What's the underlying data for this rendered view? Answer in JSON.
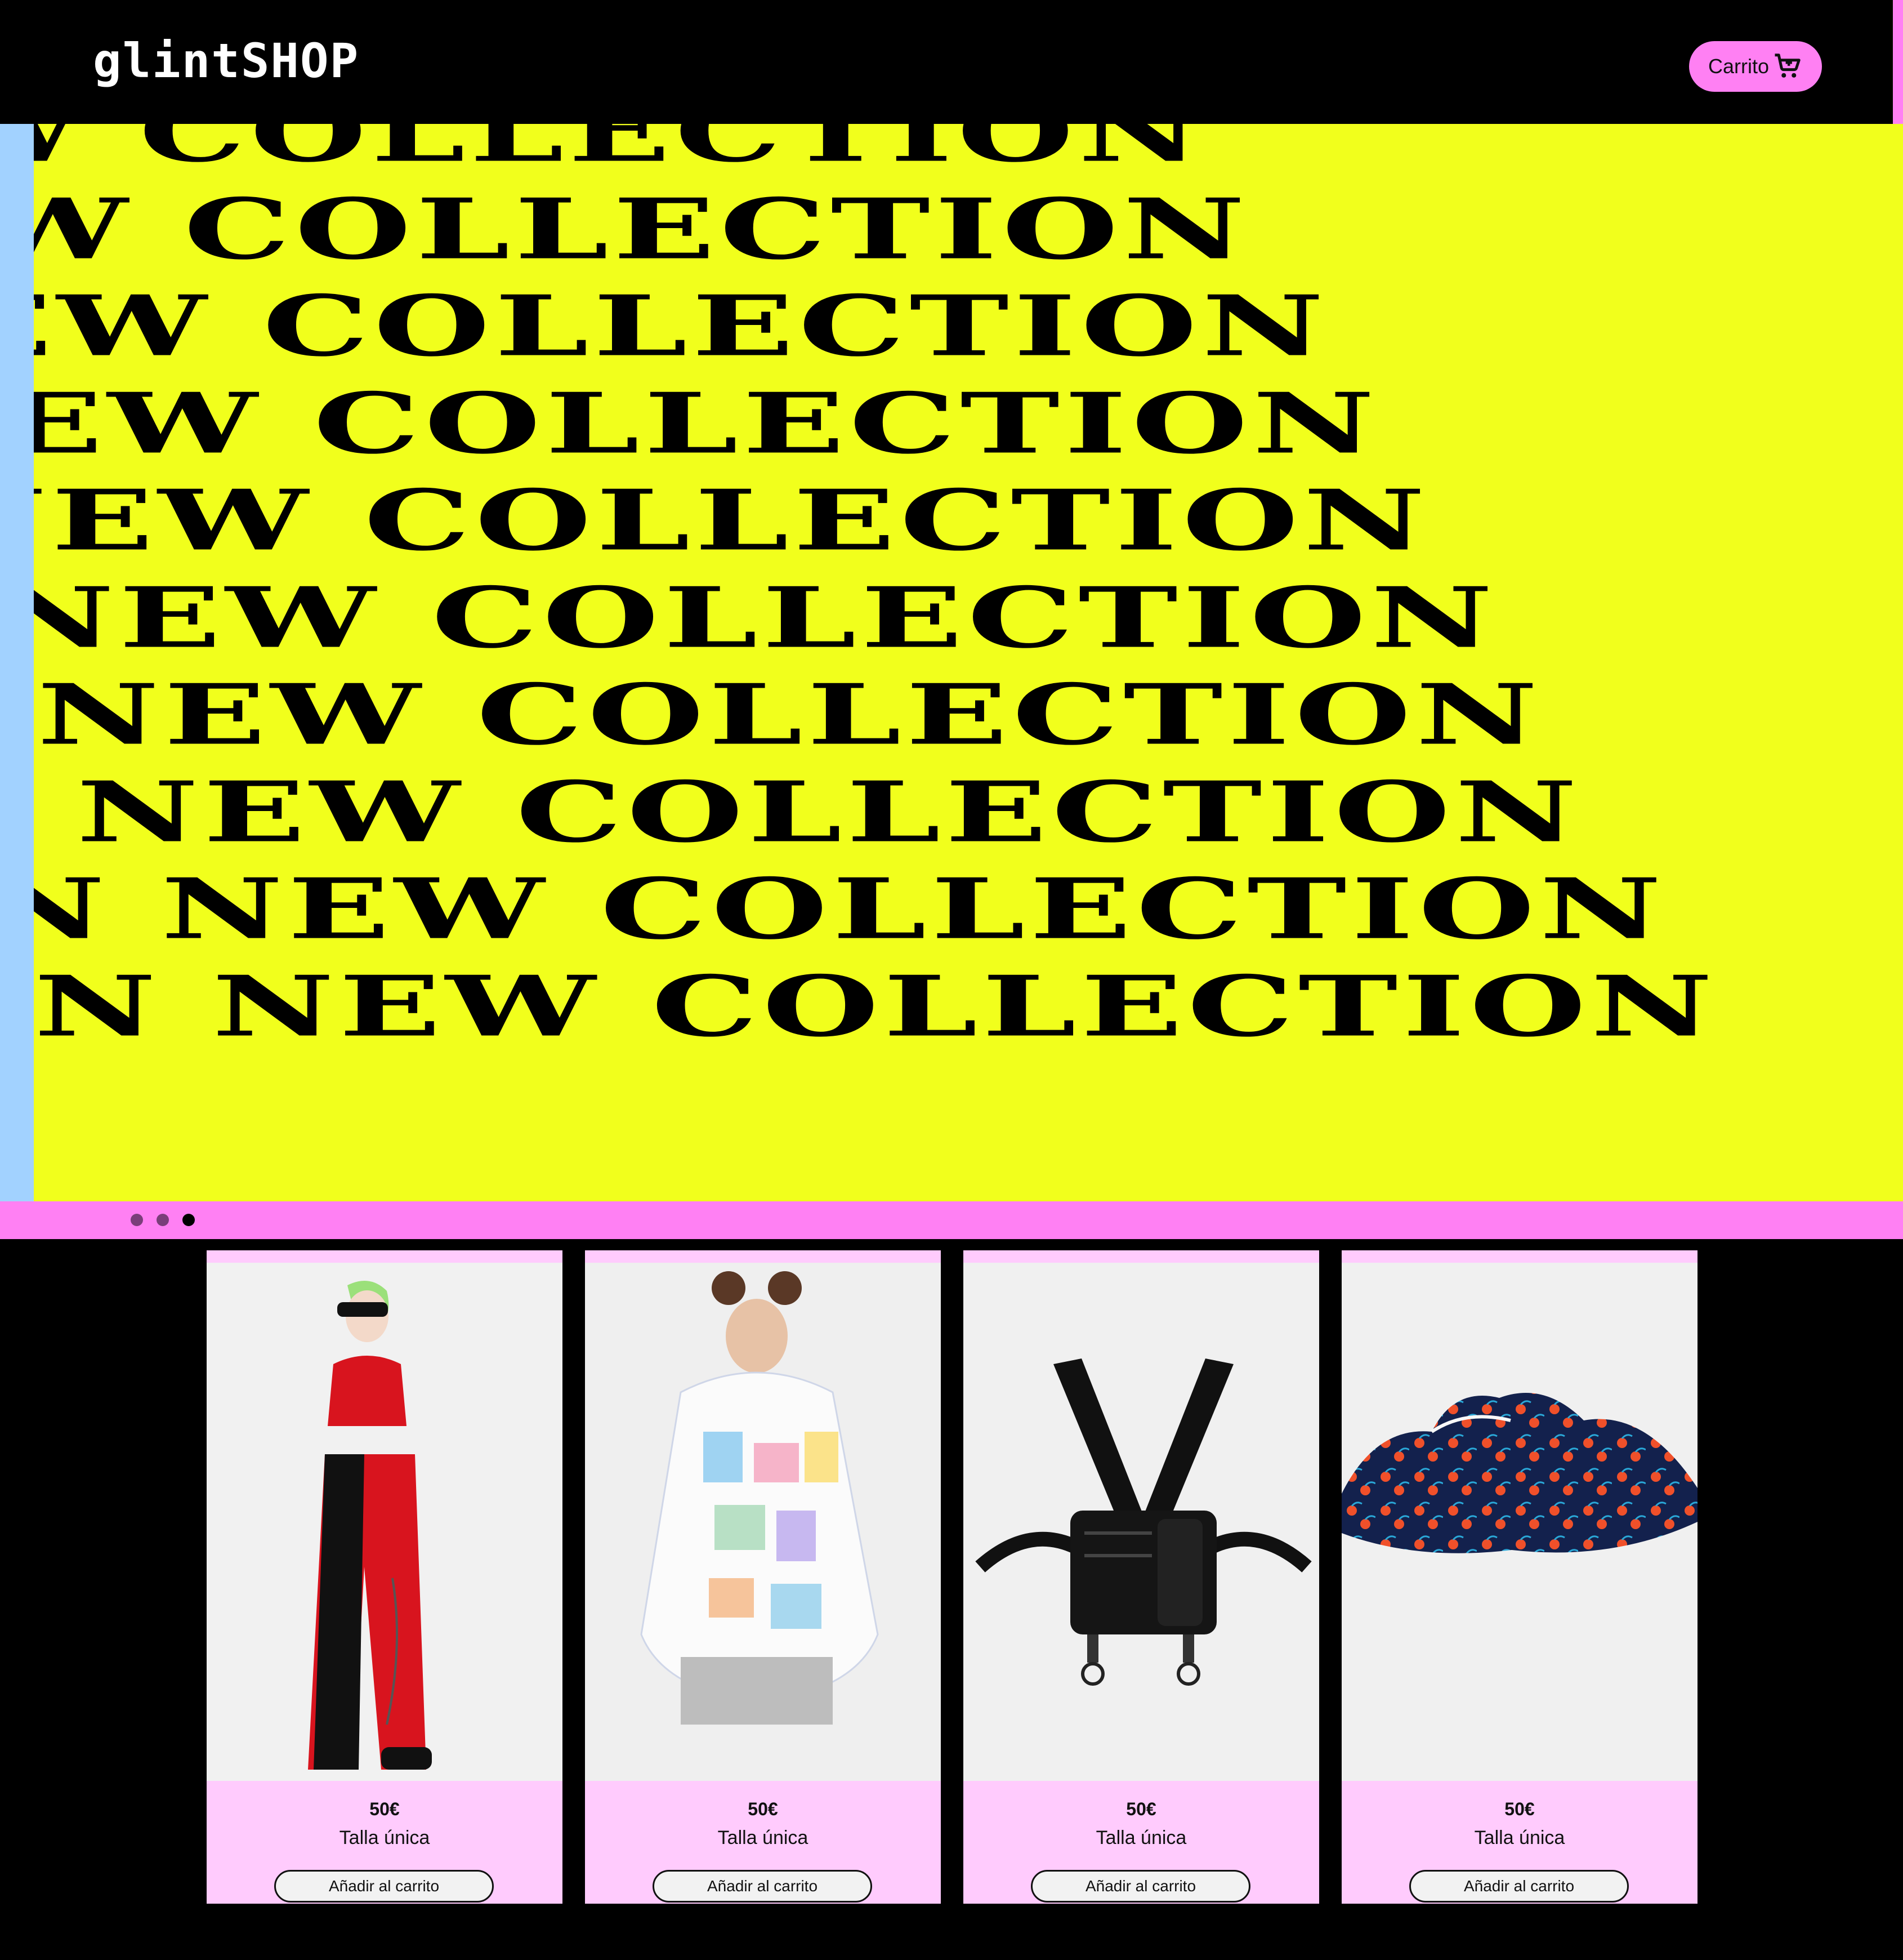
{
  "header": {
    "logo": "glintSHOP",
    "cart_label": "Carrito",
    "cart_icon": "shopping-cart-icon"
  },
  "hero": {
    "lines": [
      "ON NEW COLLECTION",
      "ION NEW COLLECTION",
      "TION NEW COLLECTION",
      "ETION NEW COLLECTION",
      "ECTION NEW COLLECTION",
      "LECTION NEW COLLECTION",
      "LLECTION NEW COLLECTION",
      "OLLECTION NEW COLLECTION",
      "OLLECTION NEW COLLECTION",
      "COLLECTION NEW COLLECTION"
    ]
  },
  "carousel": {
    "dots": 3,
    "active_index": 2
  },
  "products": [
    {
      "price": "50€",
      "size": "Talla única",
      "button": "Añadir al carrito",
      "image": "red-black-cargo-pants-outfit"
    },
    {
      "price": "50€",
      "size": "Talla única",
      "button": "Añadir al carrito",
      "image": "printed-oversized-hoodie"
    },
    {
      "price": "50€",
      "size": "Talla única",
      "button": "Añadir al carrito",
      "image": "black-harness-chest-bag"
    },
    {
      "price": "50€",
      "size": "Talla única",
      "button": "Añadir al carrito",
      "image": "cherry-print-face-mask"
    }
  ],
  "colors": {
    "header_bg": "#000000",
    "accent_pink": "#ff80f3",
    "hero_yellow": "#f1ff1c",
    "hero_side_blue": "#a2d2ff",
    "card_info_pink": "#ffcbfd"
  }
}
